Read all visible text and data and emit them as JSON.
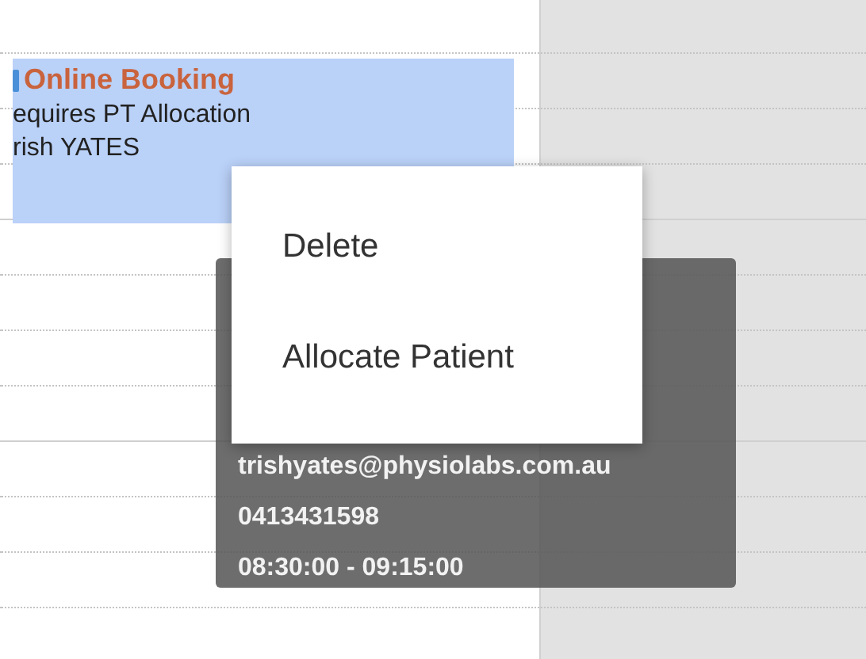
{
  "event": {
    "title": "Online Booking",
    "lines": [
      "equires PT Allocation",
      "rish YATES"
    ]
  },
  "context_menu": {
    "items": [
      {
        "label": "Delete"
      },
      {
        "label": "Allocate Patient"
      }
    ]
  },
  "tooltip": {
    "lines": [
      "trishyates@physiolabs.com.au",
      "0413431598",
      "08:30:00 - 09:15:00"
    ]
  }
}
